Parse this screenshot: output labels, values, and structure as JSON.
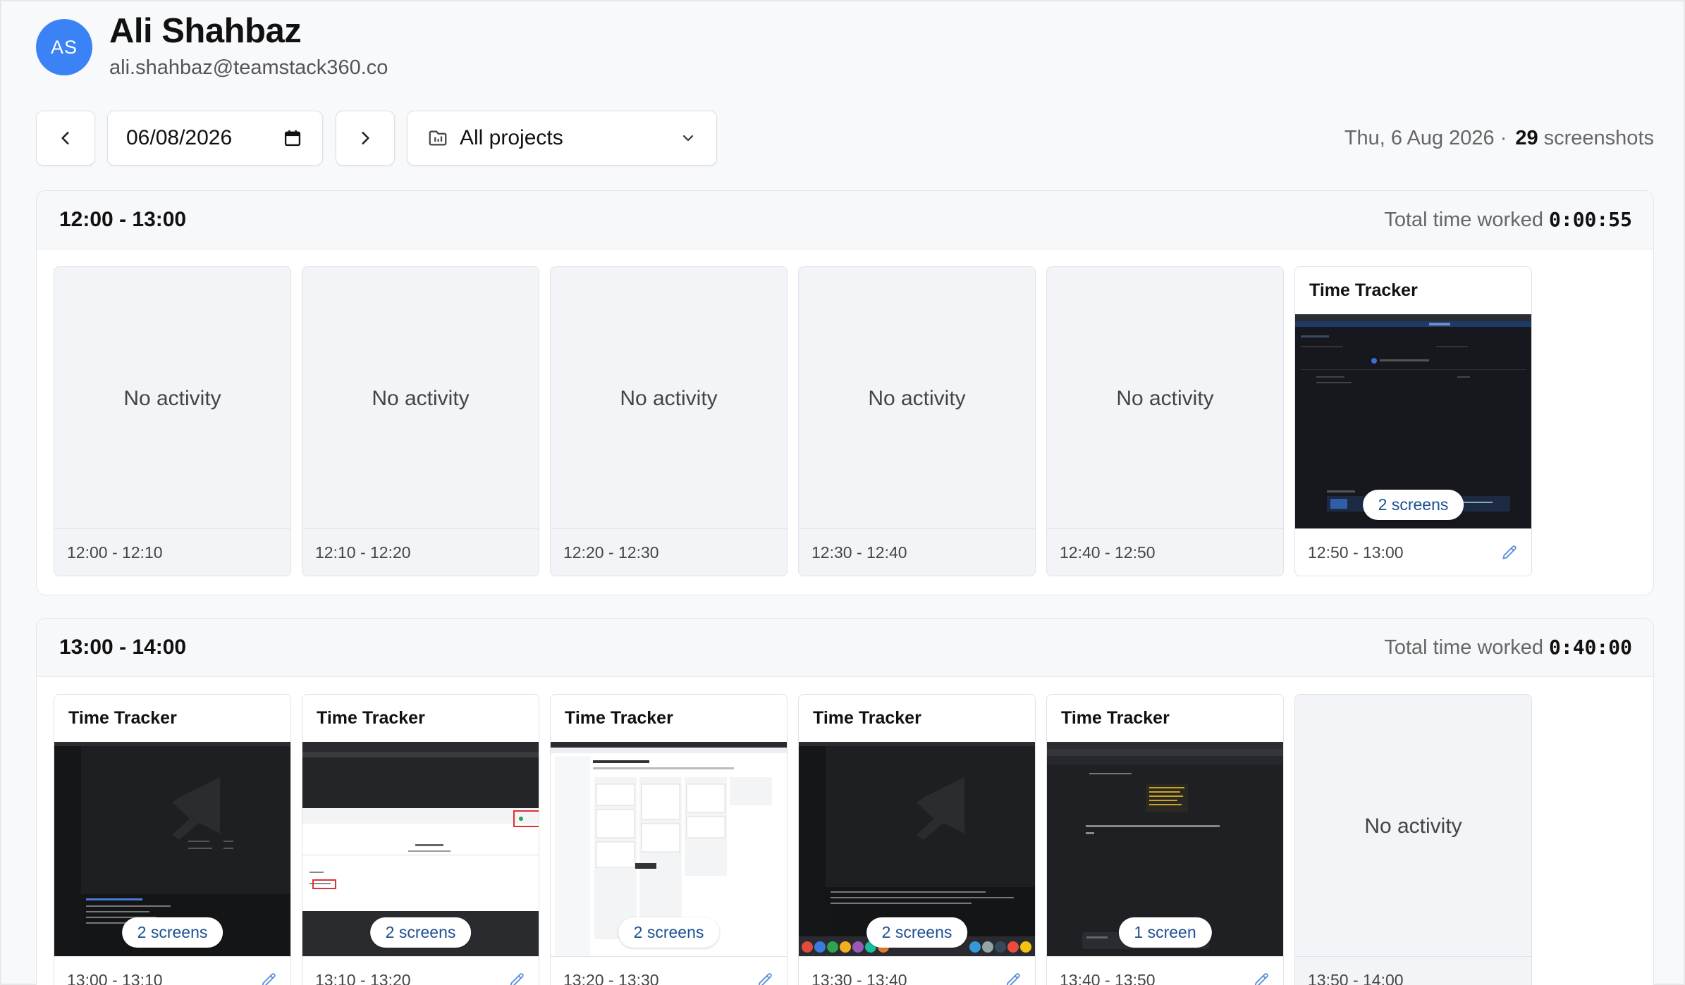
{
  "user": {
    "initials": "AS",
    "name": "Ali Shahbaz",
    "email": "ali.shahbaz@teamstack360.co"
  },
  "toolbar": {
    "date_value": "06/08/2026",
    "project_select": "All projects",
    "summary_date": "Thu, 6 Aug 2026 ·",
    "summary_count": "29",
    "summary_suffix": "screenshots"
  },
  "colors": {
    "accent": "#3b82f6",
    "pill_text": "#1d4f91",
    "edit_icon": "#5b8fd6"
  },
  "sections": [
    {
      "title": "12:00 - 13:00",
      "total_label": "Total time worked",
      "total": "0:00:55",
      "cards": [
        {
          "type": "empty",
          "text": "No activity",
          "range": "12:00 - 12:10"
        },
        {
          "type": "empty",
          "text": "No activity",
          "range": "12:10 - 12:20"
        },
        {
          "type": "empty",
          "text": "No activity",
          "range": "12:20 - 12:30"
        },
        {
          "type": "empty",
          "text": "No activity",
          "range": "12:30 - 12:40"
        },
        {
          "type": "empty",
          "text": "No activity",
          "range": "12:40 - 12:50"
        },
        {
          "type": "shot",
          "title": "Time Tracker",
          "screens": "2 screens",
          "range": "12:50 - 13:00",
          "thumb": "dark-app"
        }
      ]
    },
    {
      "title": "13:00 - 14:00",
      "total_label": "Total time worked",
      "total": "0:40:00",
      "cards": [
        {
          "type": "shot",
          "title": "Time Tracker",
          "screens": "2 screens",
          "range": "13:00 - 13:10",
          "thumb": "vscode"
        },
        {
          "type": "shot",
          "title": "Time Tracker",
          "screens": "2 screens",
          "range": "13:10 - 13:20",
          "thumb": "light-form"
        },
        {
          "type": "shot",
          "title": "Time Tracker",
          "screens": "2 screens",
          "range": "13:20 - 13:30",
          "thumb": "board"
        },
        {
          "type": "shot",
          "title": "Time Tracker",
          "screens": "2 screens",
          "range": "13:30 - 13:40",
          "thumb": "vscode-dock"
        },
        {
          "type": "shot",
          "title": "Time Tracker",
          "screens": "1 screen",
          "range": "13:40 - 13:50",
          "thumb": "dark-browser"
        },
        {
          "type": "empty",
          "text": "No activity",
          "range": "13:50 - 14:00"
        }
      ]
    }
  ]
}
